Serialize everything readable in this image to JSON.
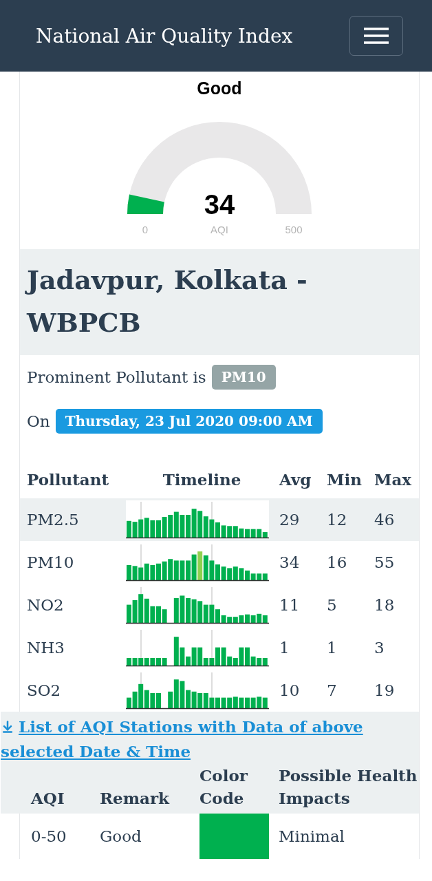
{
  "header": {
    "title": "National Air Quality Index"
  },
  "gauge": {
    "remark": "Good",
    "value": "34",
    "label": "AQI",
    "min": "0",
    "max": "500",
    "level": 0.068
  },
  "station": {
    "name": "Jadavpur, Kolkata - WBPCB"
  },
  "prominent": {
    "text": "Prominent Pollutant is",
    "pollutant": "PM10"
  },
  "date": {
    "prefix": "On",
    "value": "Thursday, 23 Jul 2020 09:00 AM"
  },
  "pollutants": {
    "columns": [
      "Pollutant",
      "Timeline",
      "Avg",
      "Min",
      "Max"
    ],
    "rows": [
      {
        "name": "PM2.5",
        "avg": "29",
        "min": "12",
        "max": "46",
        "selected": true
      },
      {
        "name": "PM10",
        "avg": "34",
        "min": "16",
        "max": "55",
        "selected": false
      },
      {
        "name": "NO2",
        "avg": "11",
        "min": "5",
        "max": "18",
        "selected": false
      },
      {
        "name": "NH3",
        "avg": "1",
        "min": "1",
        "max": "3",
        "selected": false
      },
      {
        "name": "SO2",
        "avg": "10",
        "min": "7",
        "max": "19",
        "selected": false
      }
    ]
  },
  "stations_link": {
    "text": "List of AQI Stations with Data of above selected Date & Time"
  },
  "legend": {
    "columns": [
      "AQI",
      "Remark",
      "Color Code",
      "Possible Health Impacts"
    ],
    "rows": [
      {
        "range": "0-50",
        "remark": "Good",
        "color": "#00b04f",
        "impact": "Minimal"
      }
    ]
  }
}
